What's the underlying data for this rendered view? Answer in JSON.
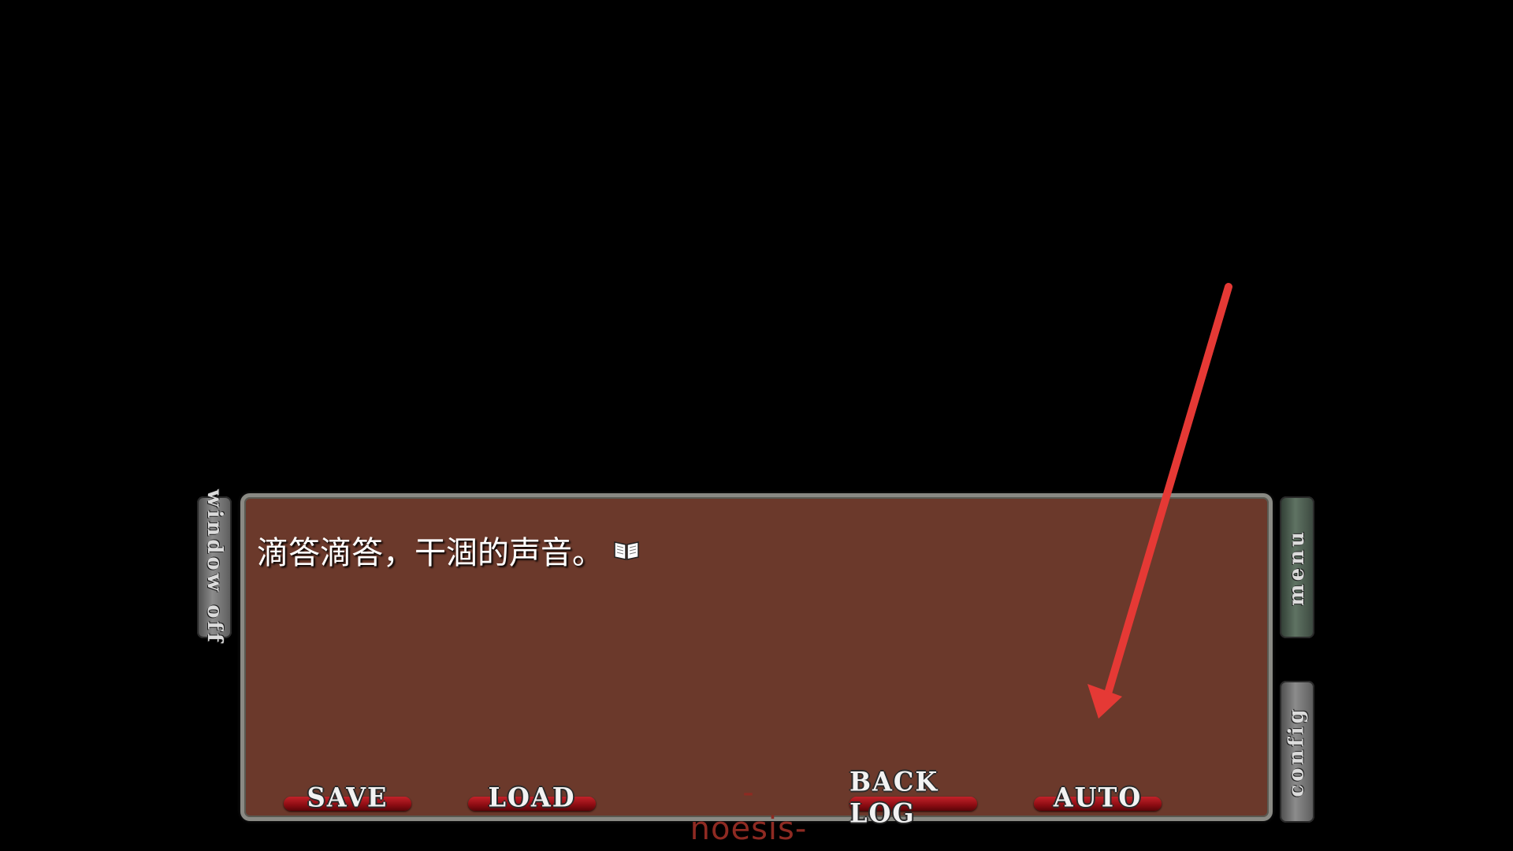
{
  "dialog": {
    "text": "滴答滴答，干涸的声音。",
    "icon": "book-icon"
  },
  "side_tabs": {
    "window_off": "window off",
    "menu": "menu",
    "config": "config"
  },
  "buttons": {
    "save": "SAVE",
    "load": "LOAD",
    "backlog": "BACK LOG",
    "auto": "AUTO"
  },
  "brand": "-noesis-",
  "colors": {
    "dialog_bg": "#6b392b",
    "button_red": "#c4222a",
    "annotation_arrow": "#e53935"
  }
}
